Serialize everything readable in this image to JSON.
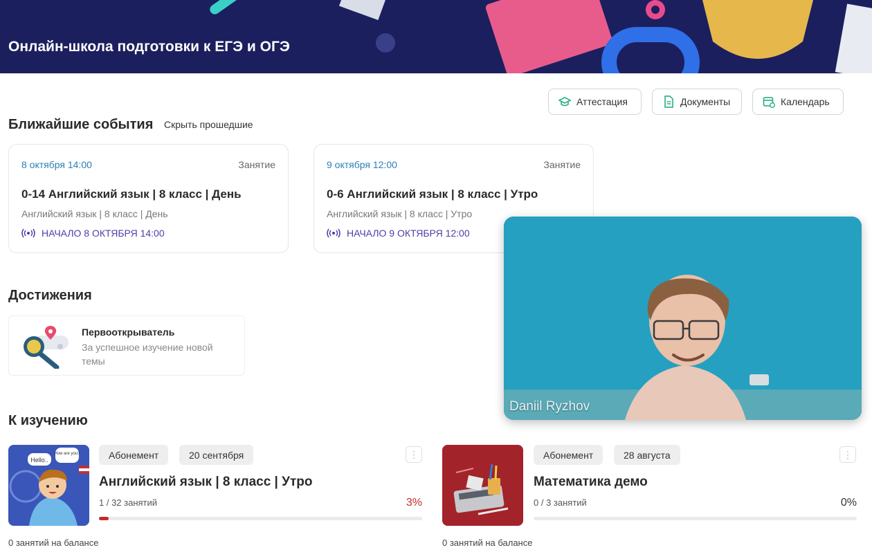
{
  "banner": {
    "title": "Онлайн-школа подготовки к ЕГЭ и ОГЭ"
  },
  "toolbar": {
    "attestation_label": "Аттестация",
    "documents_label": "Документы",
    "calendar_label": "Календарь"
  },
  "events": {
    "heading": "Ближайшие события",
    "hide_past_label": "Скрыть прошедшие",
    "items": [
      {
        "date": "8 октября 14:00",
        "type": "Занятие",
        "title": "0-14 Английский язык | 8 класс | День",
        "subtitle": "Английский язык | 8 класс | День",
        "start": "НАЧАЛО 8 ОКТЯБРЯ 14:00"
      },
      {
        "date": "9 октября 12:00",
        "type": "Занятие",
        "title": "0-6 Английский язык | 8 класс | Утро",
        "subtitle": "Английский язык | 8 класс | Утро",
        "start": "НАЧАЛО 9 ОКТЯБРЯ 12:00"
      }
    ]
  },
  "achievements": {
    "heading": "Достижения",
    "items": [
      {
        "title": "Первооткрыватель",
        "description": "За успешное изучение новой темы"
      }
    ]
  },
  "video": {
    "participant_name": "Daniil Ryzhov"
  },
  "study": {
    "heading": "К изучению",
    "courses": [
      {
        "tag_type": "Абонемент",
        "tag_date": "20 сентября",
        "title": "Английский язык | 8 класс | Утро",
        "lessons": "1 / 32 занятий",
        "percent": "3%",
        "progress": 0.03,
        "balance": "0 занятий на балансе",
        "image_bubble_1": "Hello..",
        "image_bubble_2": "How are you?",
        "percent_color": "#c42b2b"
      },
      {
        "tag_type": "Абонемент",
        "tag_date": "28 августа",
        "title": "Математика демо",
        "lessons": "0 / 3 занятий",
        "percent": "0%",
        "progress": 0,
        "balance": "0 занятий на балансе",
        "percent_color": "#333333"
      }
    ]
  },
  "colors": {
    "banner_bg": "#1c1f5e",
    "accent_date": "#2a7fb8",
    "accent_start": "#4a3fa8",
    "progress": "#c42b2b"
  }
}
